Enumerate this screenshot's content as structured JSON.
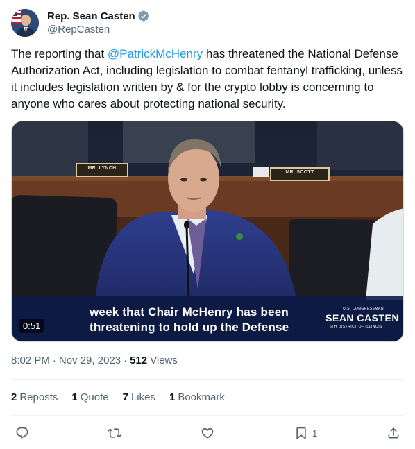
{
  "author": {
    "display_name": "Rep. Sean Casten",
    "handle": "@RepCasten"
  },
  "tweet": {
    "text_before": "The reporting that ",
    "mention": "@PatrickMcHenry",
    "text_after": " has threatened the National Defense Authorization Act, including legislation to combat fentanyl trafficking, unless it includes legislation written by & for the crypto lobby is concerning to anyone who cares about protecting national security."
  },
  "video": {
    "duration": "0:51",
    "caption_line1": "week that Chair McHenry has been",
    "caption_line2": "threatening to hold up the Defense",
    "nameplate_left": "MR. LYNCH",
    "nameplate_right": "MR. SCOTT",
    "brand_top": "U.S. CONGRESSMAN",
    "brand_name": "SEAN CASTEN",
    "brand_bottom": "6TH DISTRICT OF ILLINOIS"
  },
  "meta": {
    "time": "8:02 PM",
    "date": "Nov 29, 2023",
    "views_count": "512",
    "views_label": "Views"
  },
  "stats": {
    "reposts_count": "2",
    "reposts_label": "Reposts",
    "quote_count": "1",
    "quote_label": "Quote",
    "likes_count": "7",
    "likes_label": "Likes",
    "bookmark_count": "1",
    "bookmark_label": "Bookmark"
  },
  "actions": {
    "bookmark_count": "1"
  },
  "colors": {
    "accent": "#1d9bf0",
    "text": "#0f1419",
    "secondary": "#536471"
  }
}
